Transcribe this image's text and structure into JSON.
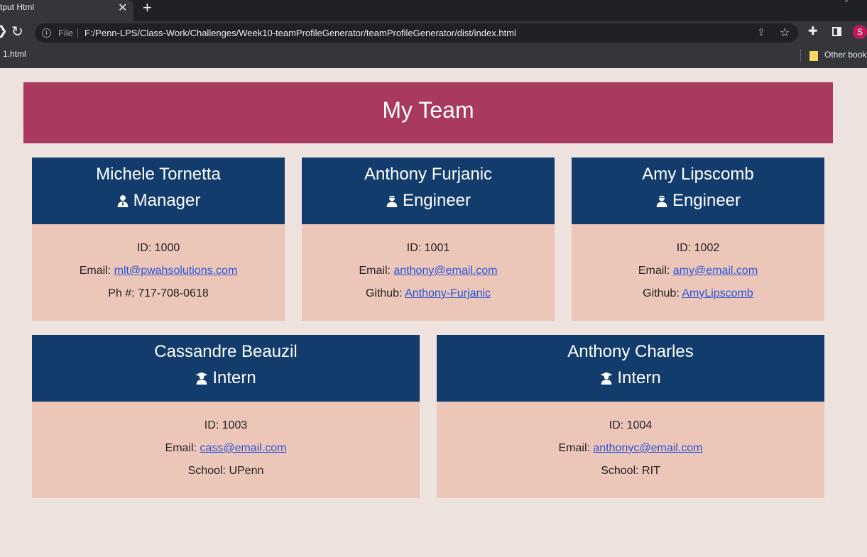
{
  "browser": {
    "tab_title": "tput Html",
    "tab_close": "✕",
    "new_tab": "+",
    "address_prefix": "File",
    "url": "F:/Penn-LPS/Class-Work/Challenges/Week10-teamProfileGenerator/teamProfileGenerator/dist/index.html",
    "bookmark_left": "1.html",
    "bookmark_right": "Other book",
    "profile_initial": "S"
  },
  "page": {
    "title": "My Team",
    "row1": [
      {
        "name": "Michele Tornetta",
        "role": "Manager",
        "icon": "manager-icon",
        "id": "ID: 1000",
        "email_label": "Email: ",
        "email": "mlt@pwahsolutions.com",
        "extra_label": "Ph #: ",
        "extra_value": "717-708-0618"
      },
      {
        "name": "Anthony Furjanic",
        "role": "Engineer",
        "icon": "engineer-icon",
        "id": "ID: 1001",
        "email_label": "Email: ",
        "email": "anthony@email.com",
        "extra_label": "Github: ",
        "extra_value": "Anthony-Furjanic"
      },
      {
        "name": "Amy Lipscomb",
        "role": "Engineer",
        "icon": "engineer-icon",
        "id": "ID: 1002",
        "email_label": "Email: ",
        "email": "amy@email.com",
        "extra_label": "Github: ",
        "extra_value": "AmyLipscomb"
      }
    ],
    "row2": [
      {
        "name": "Cassandre Beauzil",
        "role": "Intern",
        "icon": "graduate-icon",
        "id": "ID: 1003",
        "email_label": "Email: ",
        "email": "cass@email.com",
        "extra_label": "School: ",
        "extra_value": "UPenn"
      },
      {
        "name": "Anthony Charles",
        "role": "Intern",
        "icon": "graduate-icon",
        "id": "ID: 1004",
        "email_label": "Email: ",
        "email": "anthonyc@email.com",
        "extra_label": "School: ",
        "extra_value": "RIT"
      }
    ]
  },
  "colors": {
    "banner": "#a9395e",
    "card_header": "#123c6b",
    "card_body": "#ecc6b8",
    "page_background": "#ede2de",
    "link": "#2a55d8"
  }
}
